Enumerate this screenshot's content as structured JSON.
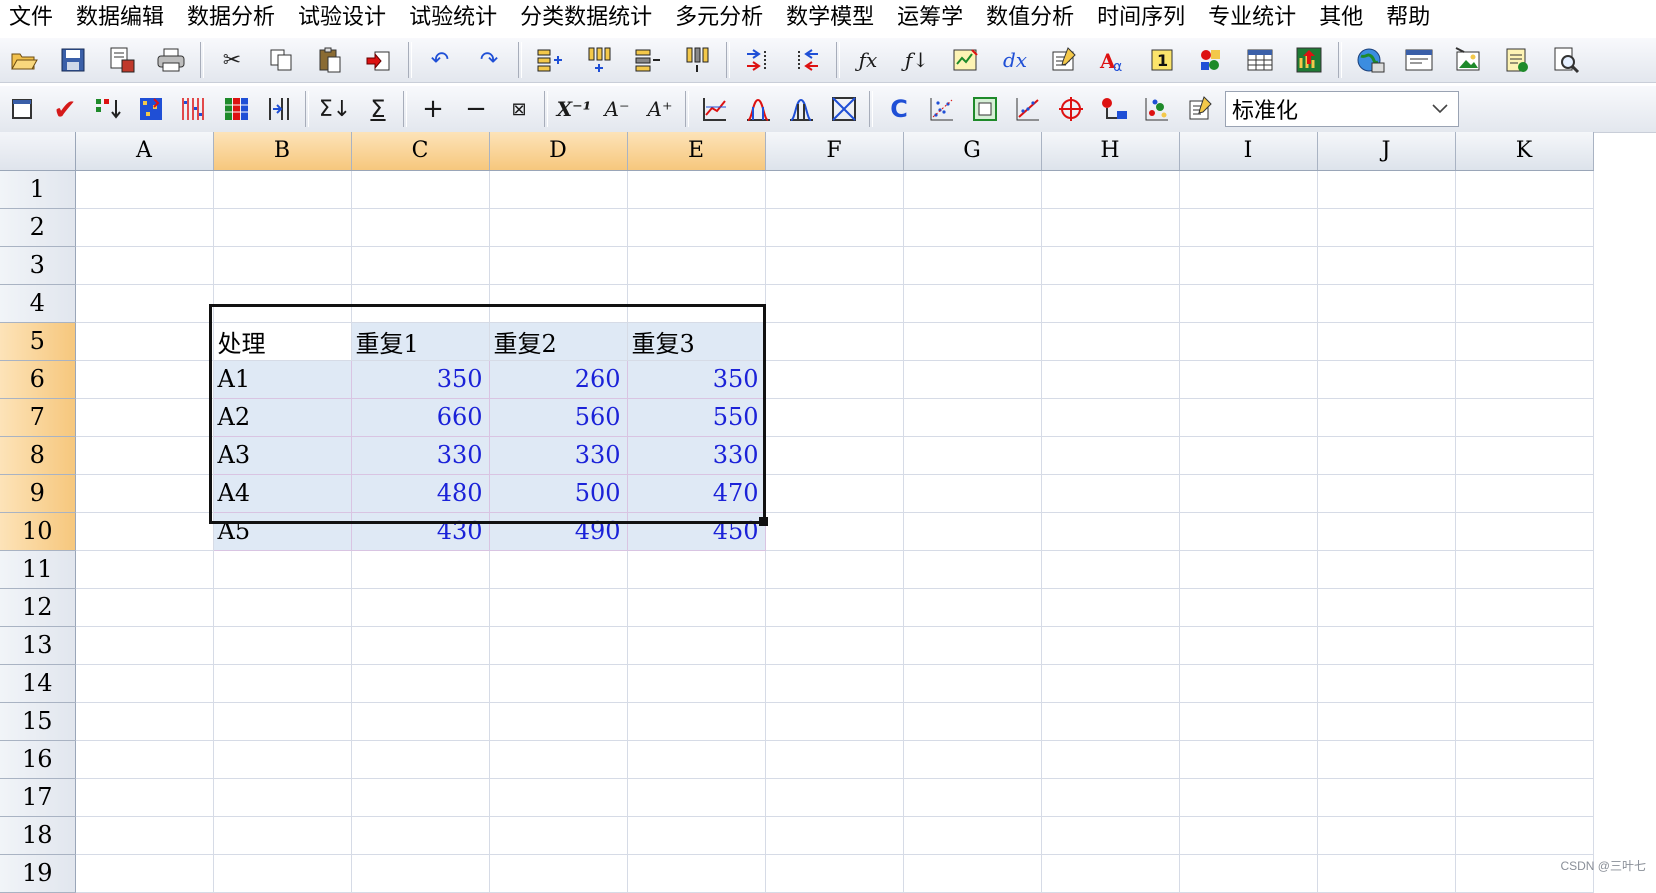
{
  "menubar": {
    "items": [
      "文件",
      "数据编辑",
      "数据分析",
      "试验设计",
      "试验统计",
      "分类数据统计",
      "多元分析",
      "数学模型",
      "运筹学",
      "数值分析",
      "时间序列",
      "专业统计",
      "其他",
      "帮助"
    ]
  },
  "toolbar2": {
    "combo_value": "标准化"
  },
  "grid": {
    "columns": [
      "A",
      "B",
      "C",
      "D",
      "E",
      "F",
      "G",
      "H",
      "I",
      "J",
      "K"
    ],
    "rows": [
      "1",
      "2",
      "3",
      "4",
      "5",
      "6",
      "7",
      "8",
      "9",
      "10",
      "11",
      "12",
      "13",
      "14",
      "15",
      "16",
      "17",
      "18",
      "19"
    ],
    "table_header": [
      "处理",
      "重复1",
      "重复2",
      "重复3"
    ],
    "table_rows": [
      [
        "A1",
        "350",
        "260",
        "350"
      ],
      [
        "A2",
        "660",
        "560",
        "550"
      ],
      [
        "A3",
        "330",
        "330",
        "330"
      ],
      [
        "A4",
        "480",
        "500",
        "470"
      ],
      [
        "A5",
        "430",
        "490",
        "450"
      ]
    ]
  },
  "watermark": "CSDN @三叶七"
}
